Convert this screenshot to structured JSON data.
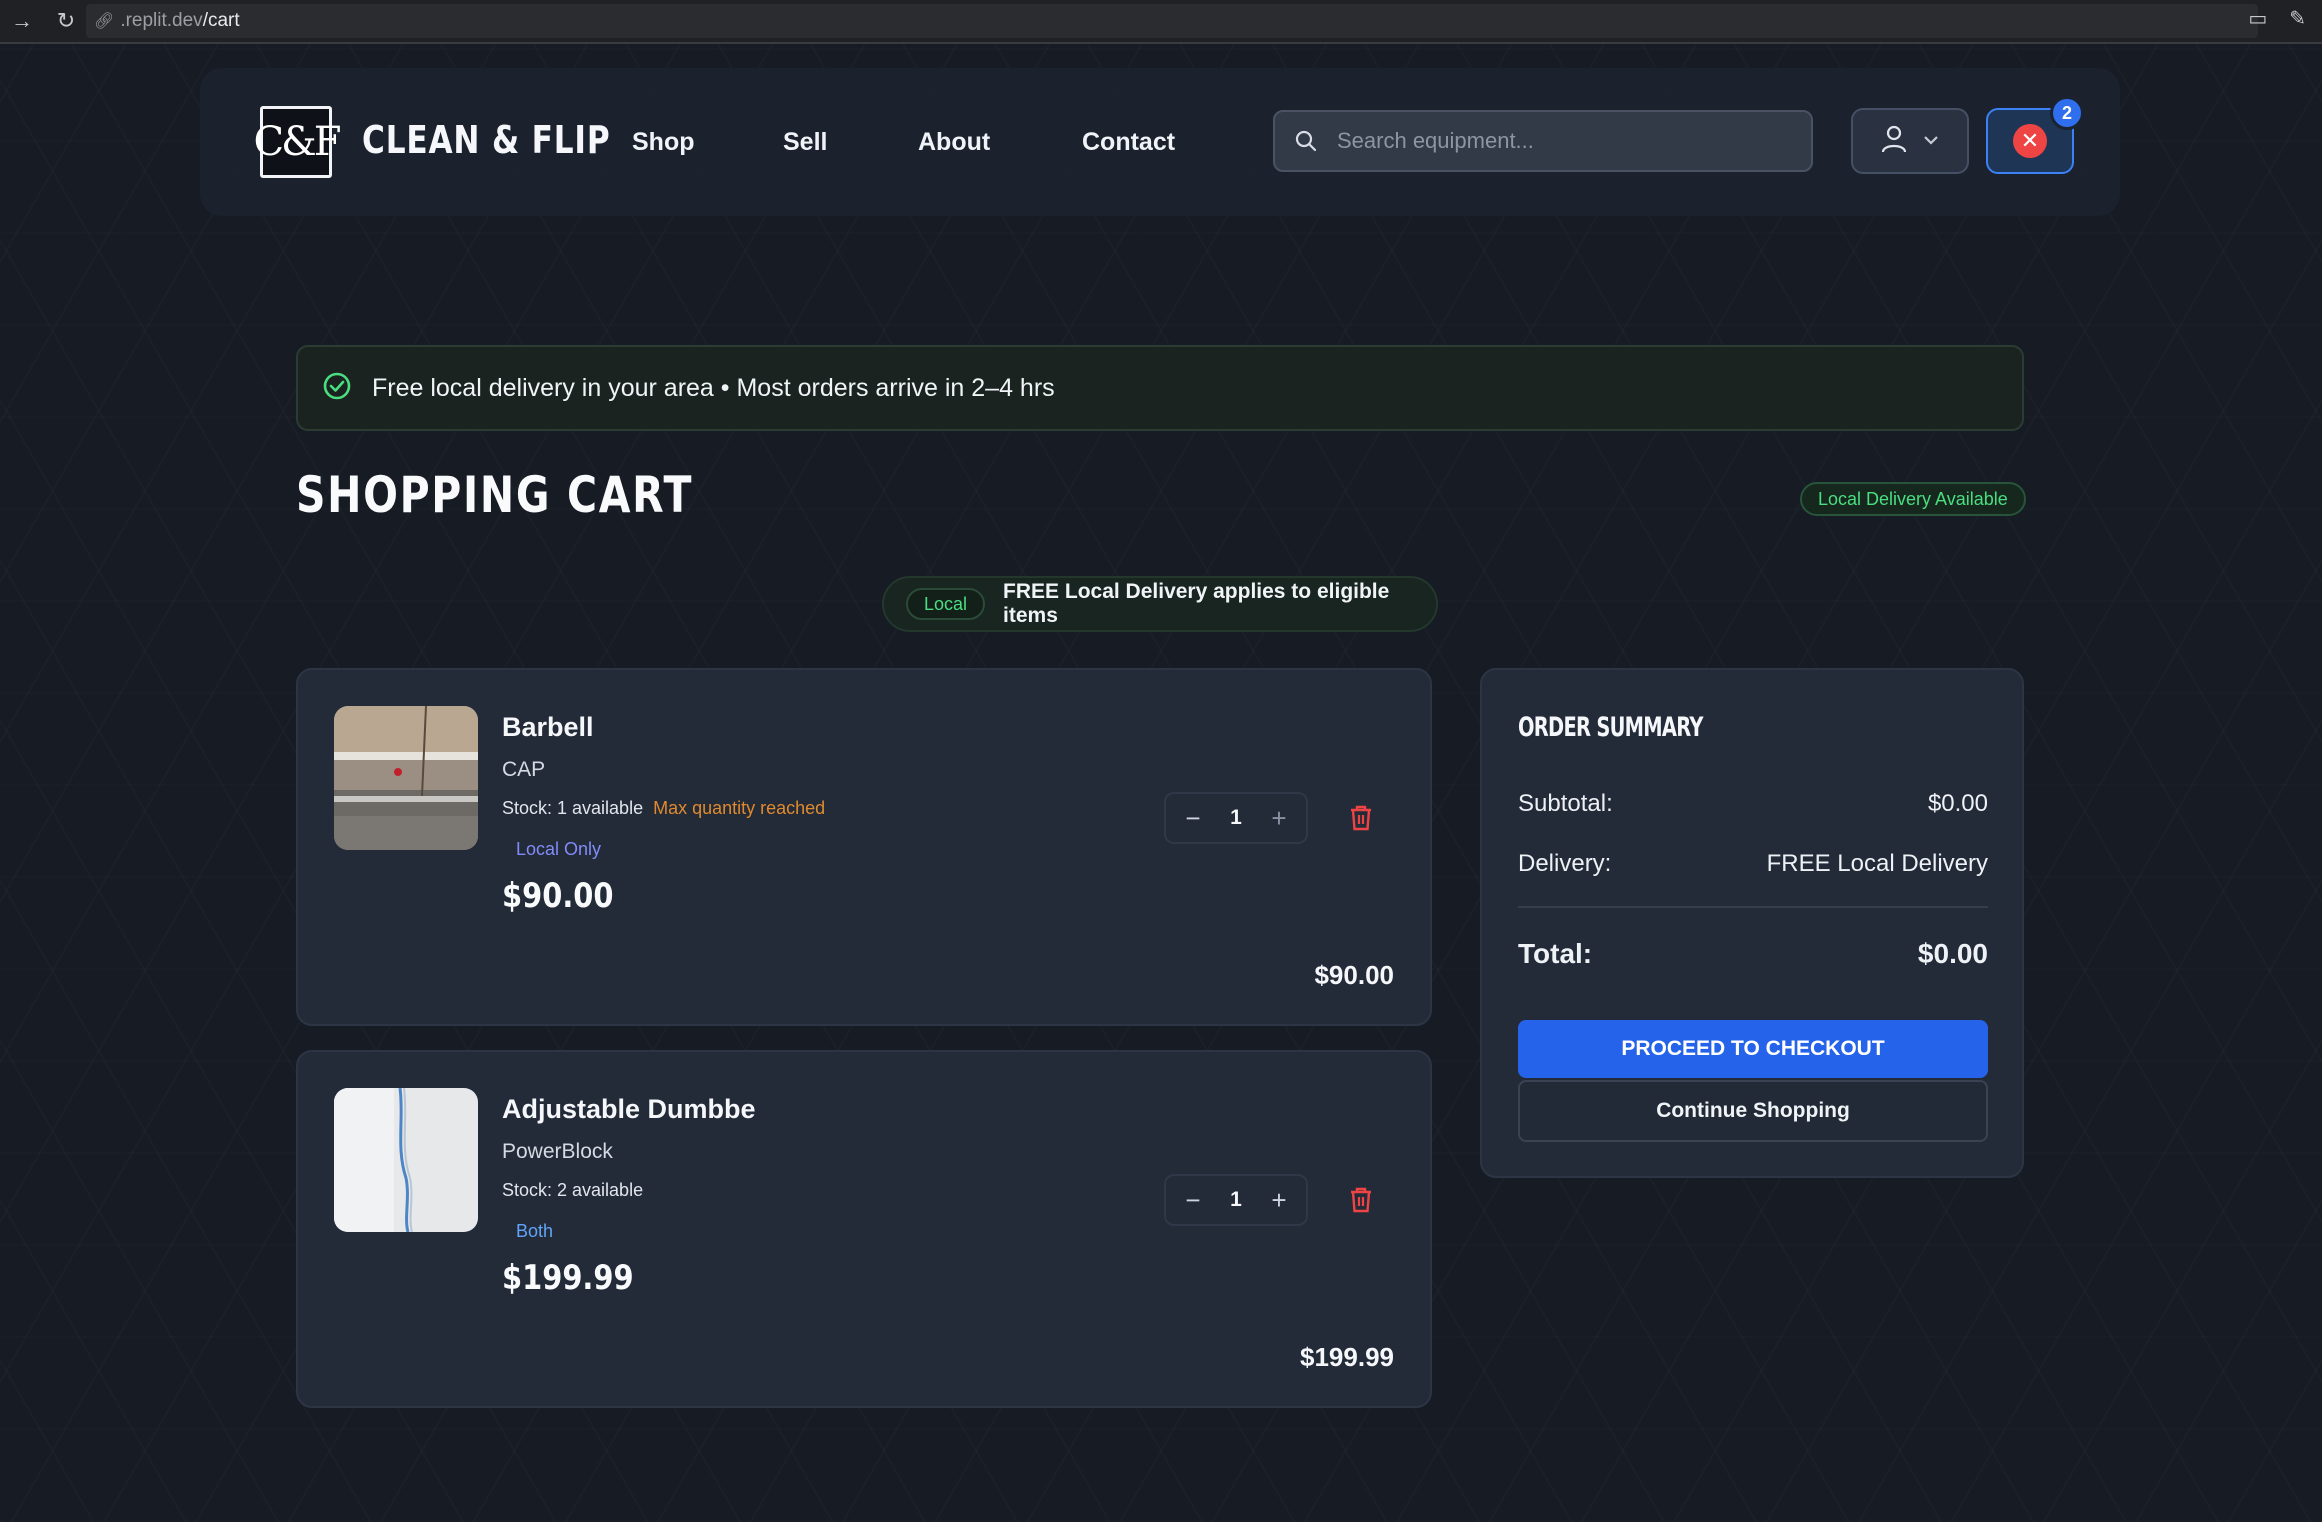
{
  "browser": {
    "url_host": ".replit.dev",
    "url_path": "/cart"
  },
  "header": {
    "logo_text": "C&F",
    "brand": "CLEAN & FLIP",
    "nav": [
      "Shop",
      "Sell",
      "About",
      "Contact"
    ],
    "search_placeholder": "Search equipment...",
    "cart_count": "2"
  },
  "banner": {
    "text": "Free local delivery in your area • Most orders arrive in 2–4 hrs"
  },
  "page": {
    "title": "SHOPPING CART",
    "availability_pill": "Local Delivery Available",
    "local_tag": "Local",
    "local_strip_text": "FREE Local Delivery applies to eligible items"
  },
  "items": [
    {
      "name": "Barbell",
      "brand": "CAP",
      "stock": "Stock: 1 available",
      "warning": "Max quantity reached",
      "tag": "Local Only",
      "tag_color": "#818cf8",
      "price": "$90.00",
      "quantity": "1",
      "line_total": "$90.00"
    },
    {
      "name": "Adjustable Dumbbe",
      "brand": "PowerBlock",
      "stock": "Stock: 2 available",
      "warning": "",
      "tag": "Both",
      "tag_color": "#60a5fa",
      "price": "$199.99",
      "quantity": "1",
      "line_total": "$199.99"
    }
  ],
  "summary": {
    "title": "ORDER SUMMARY",
    "subtotal_label": "Subtotal:",
    "subtotal_value": "$0.00",
    "delivery_label": "Delivery:",
    "delivery_value": "FREE Local Delivery",
    "total_label": "Total:",
    "total_value": "$0.00",
    "checkout_label": "PROCEED TO CHECKOUT",
    "continue_label": "Continue Shopping"
  },
  "colors": {
    "accent": "#2563eb",
    "success": "#4ade80",
    "danger": "#ef4444",
    "warning": "#e08a2e"
  }
}
